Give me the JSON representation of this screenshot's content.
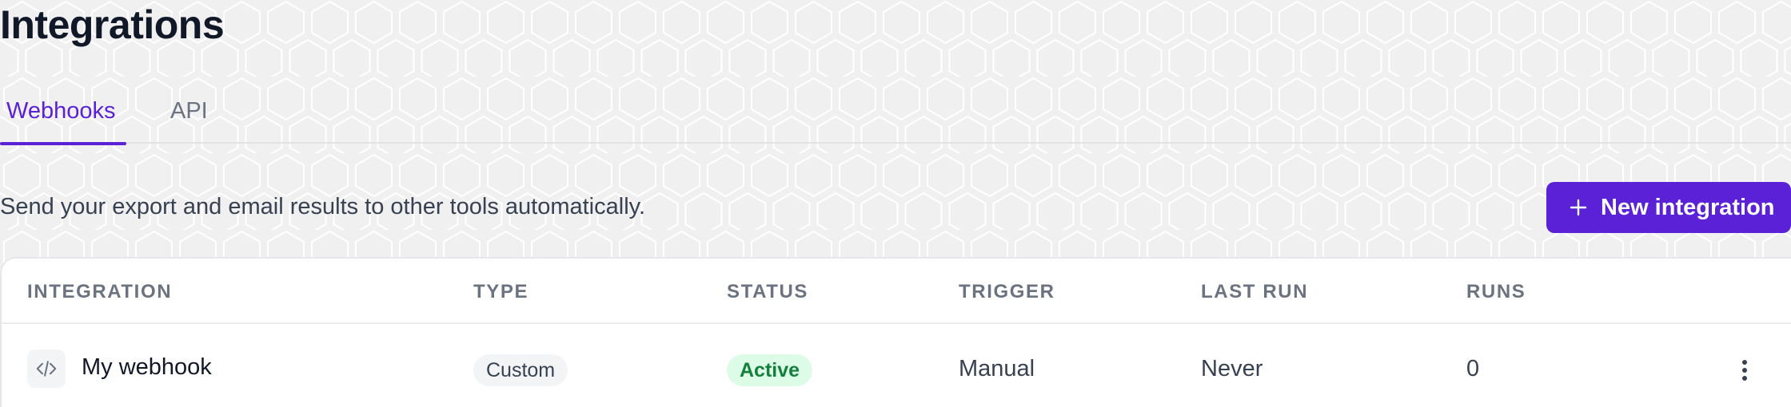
{
  "page": {
    "title": "Integrations",
    "description": "Send your export and email results to other tools automatically."
  },
  "tabs": [
    {
      "label": "Webhooks",
      "active": true
    },
    {
      "label": "API",
      "active": false
    }
  ],
  "actions": {
    "new_integration_label": "New integration",
    "new_integration_icon": "plus-icon"
  },
  "table": {
    "columns": [
      "INTEGRATION",
      "TYPE",
      "STATUS",
      "TRIGGER",
      "LAST RUN",
      "RUNS"
    ],
    "rows": [
      {
        "icon": "code-icon",
        "name": "My webhook",
        "type": "Custom",
        "status": "Active",
        "trigger": "Manual",
        "last_run": "Never",
        "runs": "0",
        "menu_icon": "more-vertical-icon"
      }
    ]
  },
  "colors": {
    "accent": "#5b21d6",
    "status_active_bg": "#dcfce7",
    "status_active_text": "#15803d",
    "background": "#f0f0f0"
  }
}
